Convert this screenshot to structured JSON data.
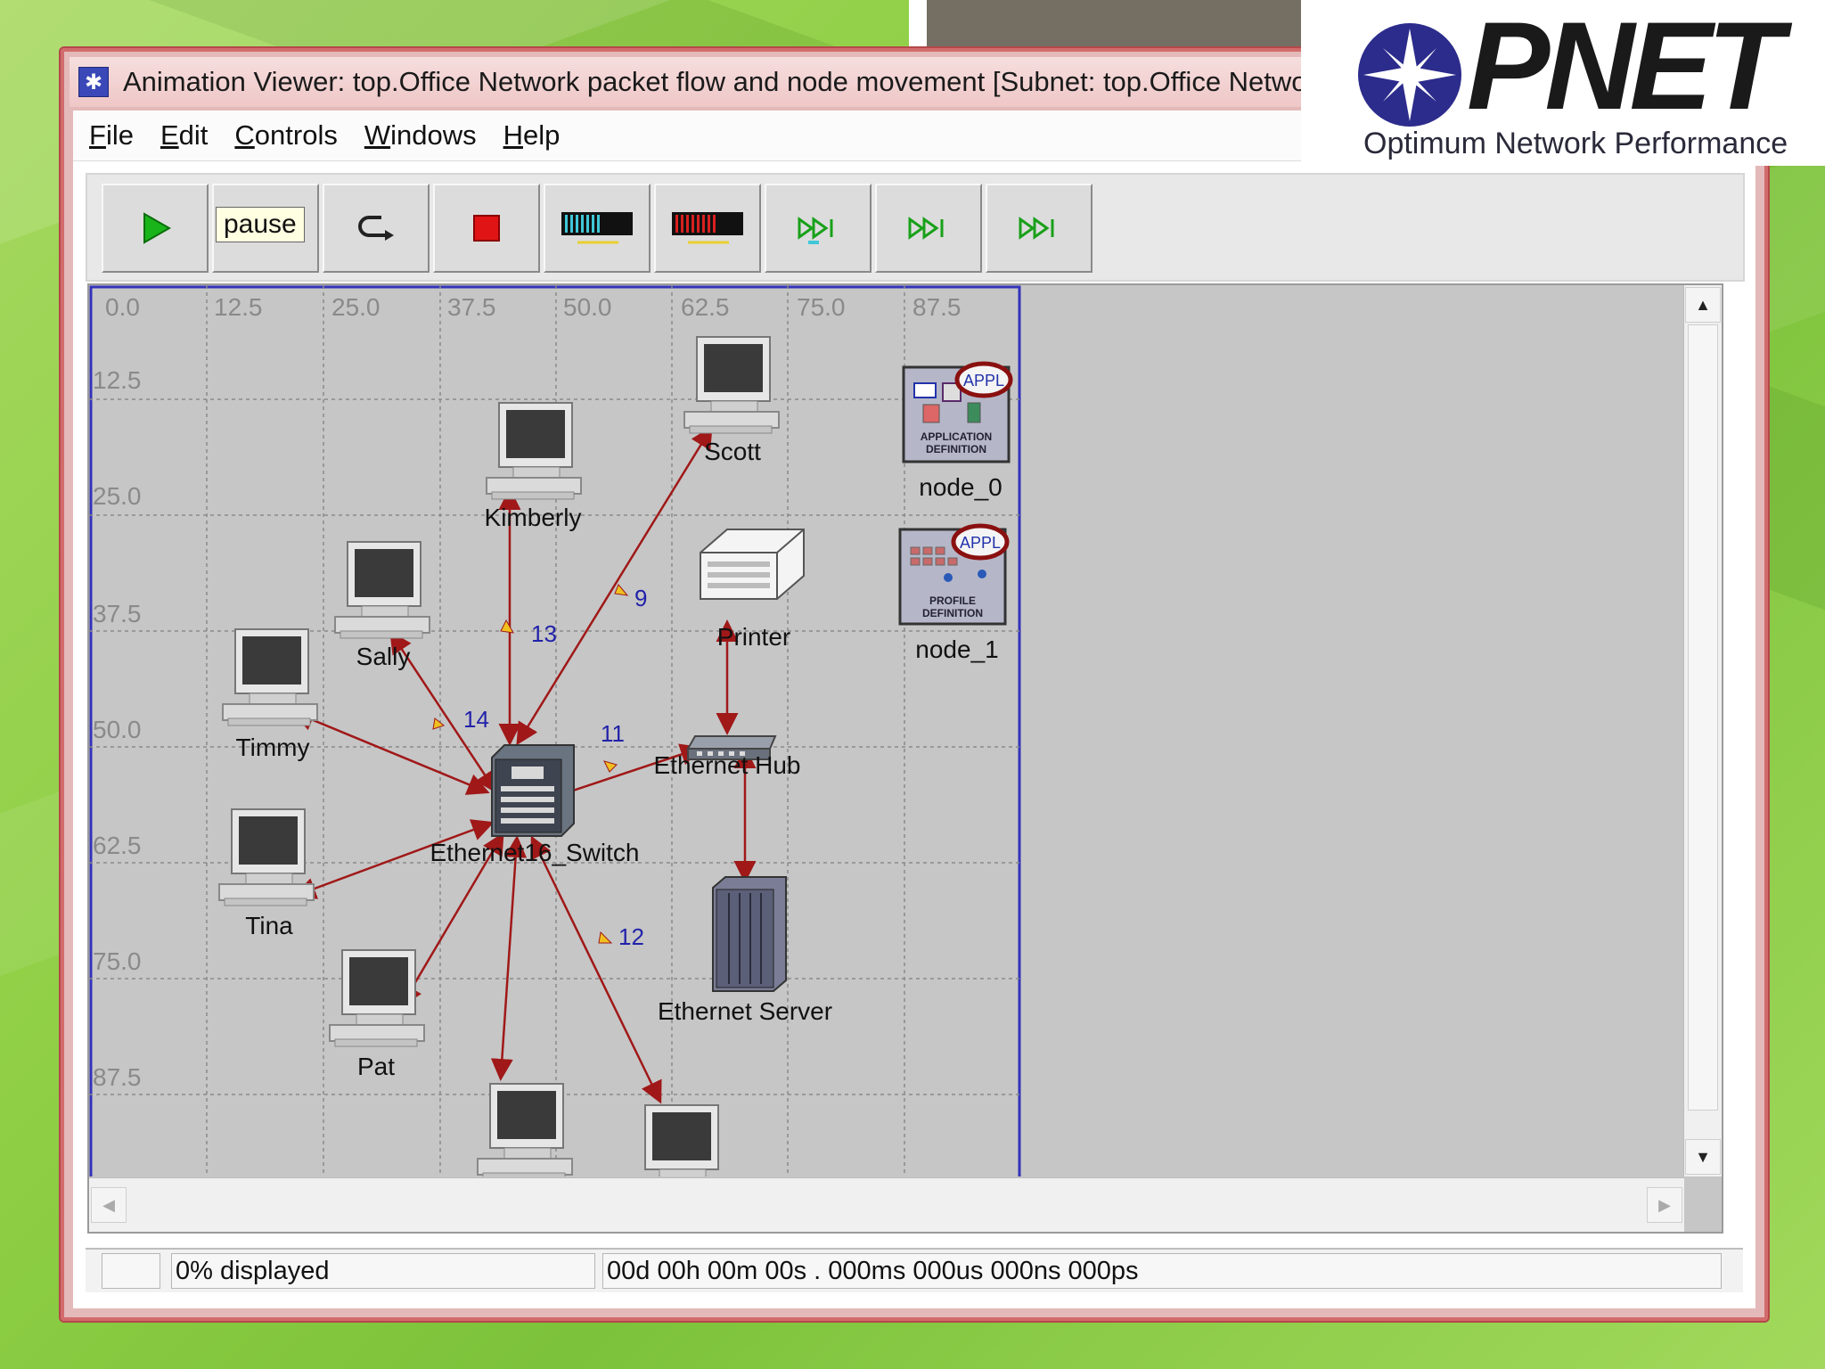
{
  "window": {
    "title": "Animation Viewer: top.Office Network packet flow and node movement  [Subnet: top.Office Network]"
  },
  "menu": {
    "file": {
      "acc": "F",
      "rest": "ile"
    },
    "edit": {
      "acc": "E",
      "rest": "dit"
    },
    "controls": {
      "acc": "C",
      "rest": "ontrols"
    },
    "windows": {
      "acc": "W",
      "rest": "indows"
    },
    "help": {
      "acc": "H",
      "rest": "elp"
    }
  },
  "toolbar": {
    "buttons": [
      {
        "name": "play",
        "icon": "play-icon"
      },
      {
        "name": "pause",
        "icon": "pause-icon"
      },
      {
        "name": "rewind",
        "icon": "rewind-icon"
      },
      {
        "name": "stop",
        "icon": "stop-icon"
      },
      {
        "name": "speed-blue",
        "icon": "speed-bar-icon"
      },
      {
        "name": "speed-red",
        "icon": "speed-bar-icon"
      },
      {
        "name": "step-forward-1",
        "icon": "fast-forward-icon"
      },
      {
        "name": "step-forward-2",
        "icon": "fast-forward-icon"
      },
      {
        "name": "step-forward-3",
        "icon": "fast-forward-icon"
      }
    ],
    "tooltip": "pause"
  },
  "grid": {
    "x_ticks": [
      "0.0",
      "12.5",
      "25.0",
      "37.5",
      "50.0",
      "62.5",
      "75.0",
      "87.5"
    ],
    "y_ticks": [
      "12.5",
      "25.0",
      "37.5",
      "50.0",
      "62.5",
      "75.0",
      "87.5"
    ]
  },
  "nodes": {
    "scott": "Scott",
    "kimberly": "Kimberly",
    "sally": "Sally",
    "timmy": "Timmy",
    "tina": "Tina",
    "pat": "Pat",
    "printer": "Printer",
    "hub": "Ethernet Hub",
    "switch": "Ethernet16_Switch",
    "server": "Ethernet Server",
    "node0": "node_0",
    "node1": "node_1",
    "appl_badge": "APPL",
    "app_def_line1": "APPLICATION",
    "app_def_line2": "DEFINITION",
    "prof_def_line1": "PROFILE",
    "prof_def_line2": "DEFINITION"
  },
  "packets": {
    "p9": "9",
    "p11": "11",
    "p12": "12",
    "p13": "13",
    "p14": "14"
  },
  "status": {
    "left": "",
    "displayed": "0% displayed",
    "time": "00d 00h 00m 00s . 000ms 000us 000ns 000ps"
  },
  "logo": {
    "word": "PNET",
    "tagline": "Optimum Network Performance"
  },
  "colors": {
    "link": "#a01818",
    "grid": "#8a8a8a",
    "label_blue": "#2222aa",
    "logo_blue": "#2c2c8c"
  }
}
